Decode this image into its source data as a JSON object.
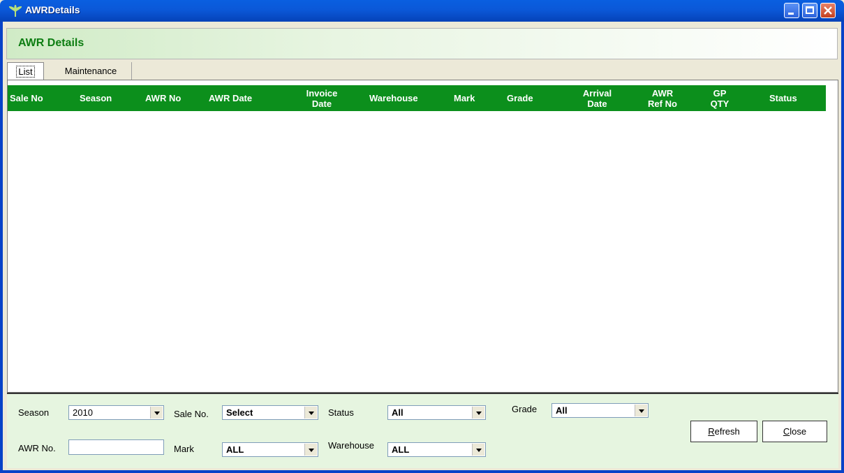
{
  "window": {
    "title": "AWRDetails"
  },
  "header": {
    "title": "AWR Details"
  },
  "tabs": [
    {
      "label": "List"
    },
    {
      "label": "Maintenance"
    }
  ],
  "grid": {
    "columns": [
      {
        "line1": "Sale No",
        "line2": ""
      },
      {
        "line1": "Season",
        "line2": ""
      },
      {
        "line1": "AWR No",
        "line2": ""
      },
      {
        "line1": "AWR Date",
        "line2": ""
      },
      {
        "line1": "Invoice",
        "line2": "Date"
      },
      {
        "line1": "Warehouse",
        "line2": ""
      },
      {
        "line1": "Mark",
        "line2": ""
      },
      {
        "line1": "Grade",
        "line2": ""
      },
      {
        "line1": "Arrival",
        "line2": "Date"
      },
      {
        "line1": "AWR",
        "line2": "Ref No"
      },
      {
        "line1": "GP",
        "line2": "QTY"
      },
      {
        "line1": "Status",
        "line2": ""
      }
    ],
    "rows": []
  },
  "filters": {
    "season": {
      "label": "Season",
      "value": "2010"
    },
    "sale_no": {
      "label": "Sale No.",
      "value": "Select"
    },
    "status": {
      "label": "Status",
      "value": "All"
    },
    "grade": {
      "label": "Grade",
      "value": "All"
    },
    "awr_no": {
      "label": "AWR No.",
      "value": ""
    },
    "mark": {
      "label": "Mark",
      "value": "ALL"
    },
    "warehouse": {
      "label": "Warehouse",
      "value": "ALL"
    }
  },
  "buttons": {
    "refresh": {
      "mnemonic": "R",
      "rest": "efresh"
    },
    "close": {
      "mnemonic": "C",
      "rest": "lose"
    }
  },
  "colors": {
    "grid_header": "#0c8f1c",
    "header_title": "#0d7d12",
    "panel": "#e6f5e0"
  }
}
